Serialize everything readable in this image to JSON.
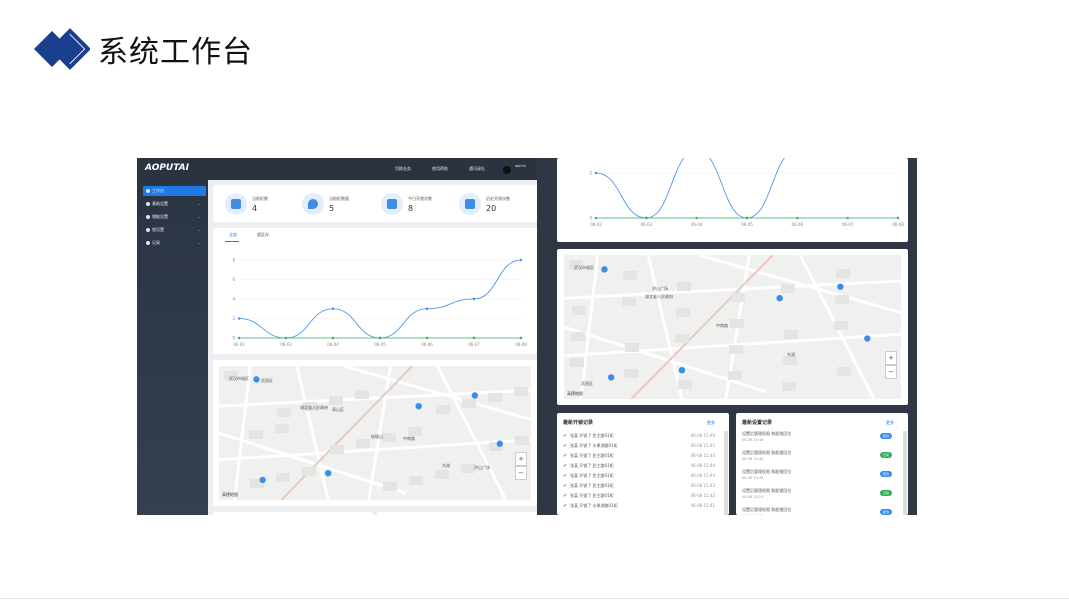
{
  "slide": {
    "title": "系统工作台"
  },
  "app": {
    "brand": "AOPUTAI",
    "topbar": {
      "items": [
        "切换业务",
        "使用帮助",
        "通讯录址"
      ],
      "user": "admin",
      "user_sub": "超级管理"
    },
    "sidebar": [
      "工作台",
      "基础设置",
      "储能设置",
      "锁设置",
      "记录"
    ],
    "stats": [
      {
        "label": "当前柜数",
        "value": "4"
      },
      {
        "label": "当前柜数量",
        "value": "5"
      },
      {
        "label": "今日开锁次数",
        "value": "8"
      },
      {
        "label": "历史开锁次数",
        "value": "20"
      }
    ],
    "tabs": [
      "全部",
      "超区存"
    ],
    "chart_data": {
      "type": "line",
      "x": [
        "06-02",
        "06-03",
        "06-04",
        "06-05",
        "06-06",
        "06-07",
        "06-08"
      ],
      "series": [
        {
          "values": [
            2,
            0,
            3,
            0,
            3,
            4,
            8
          ]
        },
        {
          "values": [
            0,
            0,
            0,
            0,
            0,
            0,
            0
          ]
        }
      ],
      "yticks": [
        0,
        2,
        4,
        6,
        8
      ],
      "ylim": [
        0,
        8
      ],
      "colors": [
        "#3b8ee8",
        "#2fb05b"
      ]
    },
    "map": {
      "labels": [
        "武汉市城区",
        "湖北省人民政府",
        "珞珈山",
        "东湖",
        "武昌区",
        "青山区",
        "中南路",
        "洪山广场"
      ],
      "attribution": "高德地图",
      "zoom_in": "+",
      "zoom_out": "−"
    },
    "map2": {
      "labels": [
        "武汉市城区",
        "湖北省人民政府",
        "中南路",
        "东湖",
        "武昌区",
        "洪山广场"
      ],
      "attribution": "高德地图"
    },
    "records_open": {
      "title": "最新开锁记录",
      "more": "更多",
      "rows": [
        {
          "text": "张某 开锁了 民主路01柜",
          "time": "06-08 15:46"
        },
        {
          "text": "张某 开锁了 水果湖路01柜",
          "time": "06-08 15:45"
        },
        {
          "text": "张某 开锁了 民主路01柜",
          "time": "06-08 15:44"
        },
        {
          "text": "张某 开锁了 民主路01柜",
          "time": "06-08 15:44"
        },
        {
          "text": "张某 开锁了 民主路01柜",
          "time": "06-08 15:44"
        },
        {
          "text": "张某 开锁了 民主路01柜",
          "time": "06-08 15:43"
        },
        {
          "text": "张某 开锁了 民主路01柜",
          "time": "06-08 15:42"
        },
        {
          "text": "张某 开锁了 水果湖路01柜",
          "time": "06-08 15:41"
        }
      ]
    },
    "records_alarm": {
      "title": "最新设置记录",
      "more": "更多",
      "rows": [
        {
          "text": "设置后管理权限 和配锁回位",
          "time": "06-08 15:46",
          "badge": "配位",
          "color": "#3b8ee8"
        },
        {
          "text": "设置后管理权限 和配锁回位",
          "time": "06-08 15:46",
          "badge": "已完",
          "color": "#2fb05b"
        },
        {
          "text": "设置后管理权限 和配锁回位",
          "time": "06-08 15:45",
          "badge": "配位",
          "color": "#3b8ee8"
        },
        {
          "text": "设置后管理权限 和配锁回位",
          "time": "06-08 15:24",
          "badge": "已完",
          "color": "#2fb05b"
        },
        {
          "text": "设置后管理权限 和配锁回位",
          "time": "06-08 15:23",
          "badge": "配位",
          "color": "#3b8ee8"
        }
      ]
    }
  }
}
